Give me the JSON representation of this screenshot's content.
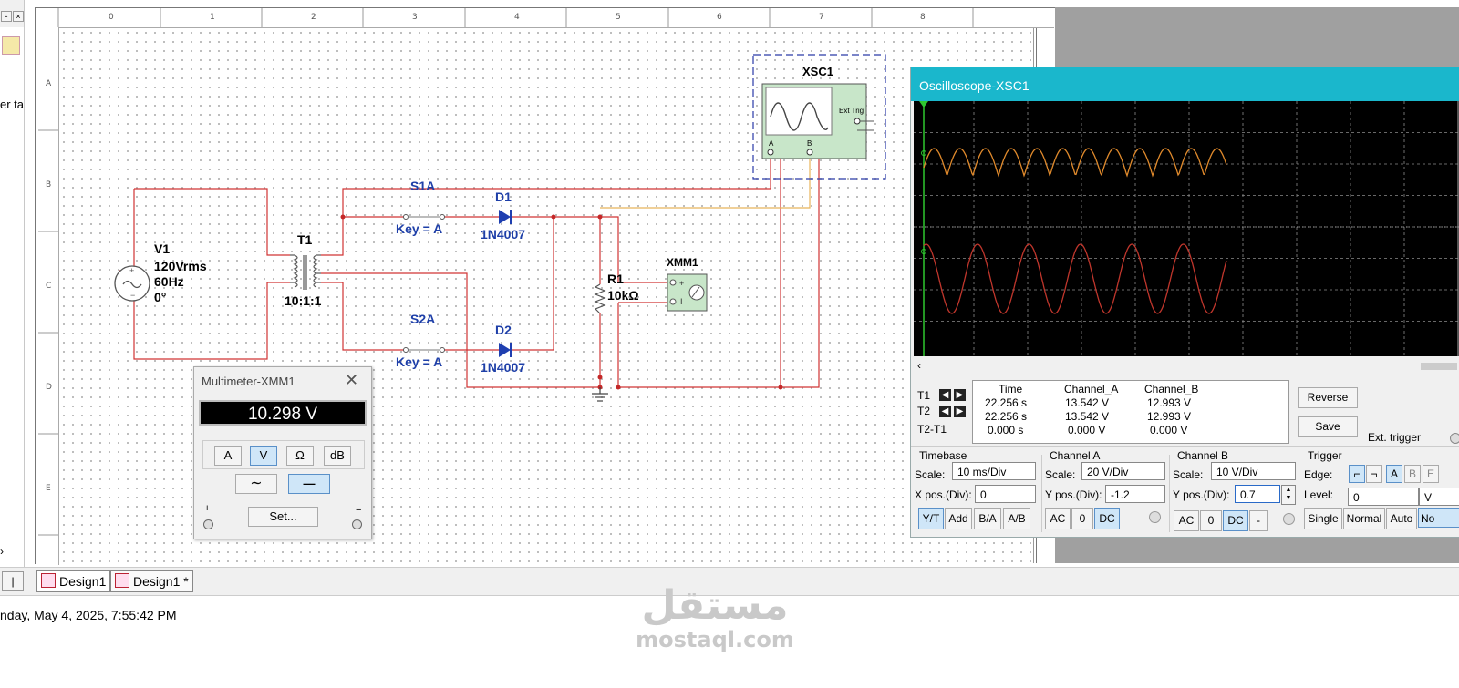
{
  "left_panel": {
    "text": "er ta",
    "arrow": "›"
  },
  "ruler": {
    "columns": [
      "0",
      "1",
      "2",
      "3",
      "4",
      "5",
      "6",
      "7",
      "8"
    ],
    "rows": [
      "A",
      "B",
      "C",
      "D",
      "E"
    ]
  },
  "schematic": {
    "source": {
      "name": "V1",
      "voltage": "120Vrms",
      "frequency": "60Hz",
      "phase": "0°"
    },
    "transformer": {
      "name": "T1",
      "ratio": "10:1:1"
    },
    "switch1": {
      "name": "S1A",
      "key": "Key = A"
    },
    "switch2": {
      "name": "S2A",
      "key": "Key = A"
    },
    "diode1": {
      "name": "D1",
      "part": "1N4007"
    },
    "diode2": {
      "name": "D2",
      "part": "1N4007"
    },
    "resistor": {
      "name": "R1",
      "value": "10kΩ"
    },
    "multimeter_symbol": {
      "name": "XMM1"
    },
    "scope_symbol": {
      "name": "XSC1",
      "ext_trig": "Ext Trig",
      "ch_a": "A",
      "ch_b": "B"
    }
  },
  "tabs": [
    {
      "label": "Design1"
    },
    {
      "label": "Design1 *"
    }
  ],
  "status": {
    "text": "nday, May 4, 2025, 7:55:42 PM"
  },
  "multimeter": {
    "title": "Multimeter-XMM1",
    "close": "✕",
    "reading": "10.298 V",
    "modes": [
      "A",
      "V",
      "Ω",
      "dB"
    ],
    "active_mode": "V",
    "ac_symbol": "∼",
    "dc_symbol": "—",
    "set_label": "Set...",
    "plus": "+",
    "minus": "−"
  },
  "oscilloscope": {
    "title": "Oscilloscope-XSC1",
    "readout": {
      "headers": [
        "Time",
        "Channel_A",
        "Channel_B"
      ],
      "rows": [
        {
          "label": "T1",
          "time": "22.256 s",
          "a": "13.542 V",
          "b": "12.993 V"
        },
        {
          "label": "T2",
          "time": "22.256 s",
          "a": "13.542 V",
          "b": "12.993 V"
        },
        {
          "label": "T2-T1",
          "time": "0.000 s",
          "a": "0.000 V",
          "b": "0.000 V"
        }
      ]
    },
    "reverse_label": "Reverse",
    "save_label": "Save",
    "ext_trigger_label": "Ext. trigger",
    "timebase": {
      "title": "Timebase",
      "scale_label": "Scale:",
      "scale": "10 ms/Div",
      "xpos_label": "X pos.(Div):",
      "xpos": "0",
      "buttons": [
        "Y/T",
        "Add",
        "B/A",
        "A/B"
      ]
    },
    "channel_a": {
      "title": "Channel A",
      "scale_label": "Scale:",
      "scale": "20  V/Div",
      "ypos_label": "Y pos.(Div):",
      "ypos": "-1.2",
      "buttons": [
        "AC",
        "0",
        "DC"
      ]
    },
    "channel_b": {
      "title": "Channel B",
      "scale_label": "Scale:",
      "scale": "10  V/Div",
      "ypos_label": "Y pos.(Div):",
      "ypos": "0.7",
      "buttons": [
        "AC",
        "0",
        "DC",
        "-"
      ]
    },
    "trigger": {
      "title": "Trigger",
      "edge_label": "Edge:",
      "level_label": "Level:",
      "level": "0",
      "level_unit": "V",
      "sources": [
        "A",
        "B",
        "E"
      ],
      "modes": [
        "Single",
        "Normal",
        "Auto",
        "No"
      ]
    },
    "colors": {
      "channel_a": "#e08a2c",
      "channel_b": "#c0362c",
      "cursor": "#2fc72f",
      "grid": "#8a8a8a"
    }
  },
  "watermark": {
    "arabic": "مستقل",
    "latin": "mostaql.com"
  }
}
